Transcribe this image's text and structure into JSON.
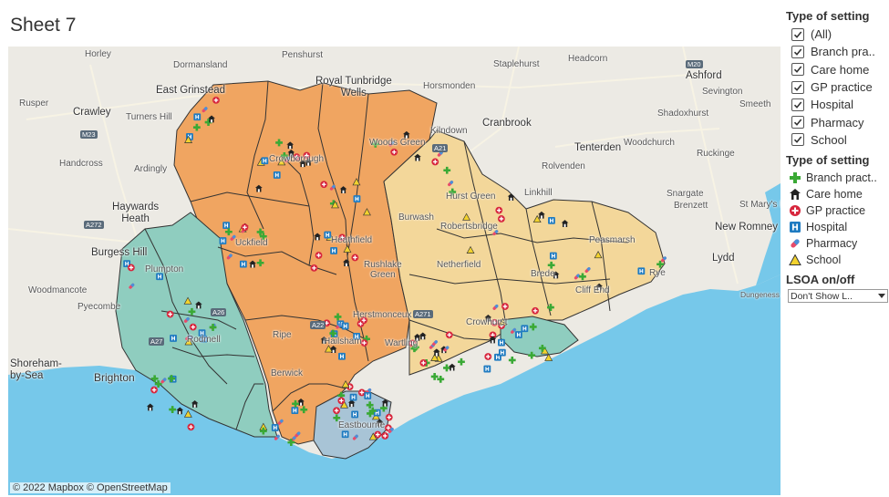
{
  "sheet": {
    "title": "Sheet 7"
  },
  "map": {
    "attribution": "© 2022 Mapbox © OpenStreetMap",
    "labels": {
      "horley": "Horley",
      "dormansland": "Dormansland",
      "penshurst": "Penshurst",
      "royal_tunbridge_wells": "Royal Tunbridge\nWells",
      "staplehurst": "Staplehurst",
      "headcorn": "Headcorn",
      "ashford": "Ashford",
      "rusper": "Rusper",
      "east_grinstead": "East Grinstead",
      "horsmonden": "Horsmonden",
      "sevington": "Sevington",
      "crawley": "Crawley",
      "turners_hill": "Turners Hill",
      "cranbrook": "Cranbrook",
      "shadoxhurst": "Shadoxhurst",
      "smeeth": "Smeeth",
      "kilndown": "Kilndown",
      "tenterden": "Tenterden",
      "woodchurch": "Woodchurch",
      "handcross": "Handcross",
      "ardingly": "Ardingly",
      "rolvenden": "Rolvenden",
      "ruckinge": "Ruckinge",
      "linkhill": "Linkhill",
      "snargate": "Snargate",
      "haywards_heath": "Haywards\nHeath",
      "brenzett": "Brenzett",
      "st_marys_bay": "St Mary's Ba",
      "new_romney": "New Romney",
      "burgess_hill": "Burgess Hill",
      "lydd": "Lydd",
      "woodmancote": "Woodmancote",
      "dungeness": "Dungeness",
      "pyecombe": "Pyecombe",
      "shoreham": "Shoreham-\nby-Sea",
      "brighton": "Brighton",
      "crowborough": "Crowborough",
      "robertsbridge": "Robertsbridge",
      "netherfield": "Netherfield",
      "herstmonceux": "Herstmonceux",
      "wartling": "Wartling",
      "berwick": "Berwick",
      "eastbourne": "Eastbourne",
      "hurst_green": "Hurst Green",
      "woods_green": "Woods Green",
      "plumpton": "Plumpton",
      "ripe": "Ripe",
      "rodmell": "Rodmell",
      "crowhurst": "Crowhurst",
      "peasmarsh": "Peasmarsh",
      "brede": "Brede",
      "cliff_end": "Cliff End",
      "rye": "Rye",
      "burwash": "Burwash",
      "uckfield": "Uckfield",
      "heathfield": "Heathfield",
      "hailsham": "Hailsham",
      "rushlake_green": "Rushlake\nGreen"
    },
    "roads": {
      "m23": "M23",
      "m20": "M20",
      "a21": "A21",
      "a272": "A272",
      "a22": "A22",
      "a27": "A27",
      "a26": "A26",
      "a271": "A271"
    },
    "colors": {
      "land": "#eceae4",
      "sea": "#76c8ea",
      "orange": "#f0a561",
      "teal": "#8fcdbf",
      "sand": "#f3d79a",
      "blue_grey": "#a8c4d6",
      "boundary": "#333333"
    }
  },
  "filters": {
    "heading": "Type of setting",
    "items": [
      {
        "label": "(All)",
        "checked": true
      },
      {
        "label": "Branch pra..",
        "checked": true
      },
      {
        "label": "Care home",
        "checked": true
      },
      {
        "label": "GP practice",
        "checked": true
      },
      {
        "label": "Hospital",
        "checked": true
      },
      {
        "label": "Pharmacy",
        "checked": true
      },
      {
        "label": "School",
        "checked": true
      }
    ]
  },
  "legend": {
    "heading": "Type of setting",
    "items": [
      {
        "label": "Branch pract..",
        "icon": "green-cross-icon",
        "color": "#3aa935"
      },
      {
        "label": "Care home",
        "icon": "care-home-icon",
        "color": "#222222"
      },
      {
        "label": "GP practice",
        "icon": "gp-cross-icon",
        "color": "#d7263d"
      },
      {
        "label": "Hospital",
        "icon": "hospital-h-icon",
        "color": "#1f7bc1"
      },
      {
        "label": "Pharmacy",
        "icon": "pill-icon",
        "color": "#e84b6a"
      },
      {
        "label": "School",
        "icon": "triangle-icon",
        "color": "#f2d22e"
      }
    ]
  },
  "lsoa": {
    "heading": "LSOA on/off",
    "selected": "Don't Show L.."
  }
}
